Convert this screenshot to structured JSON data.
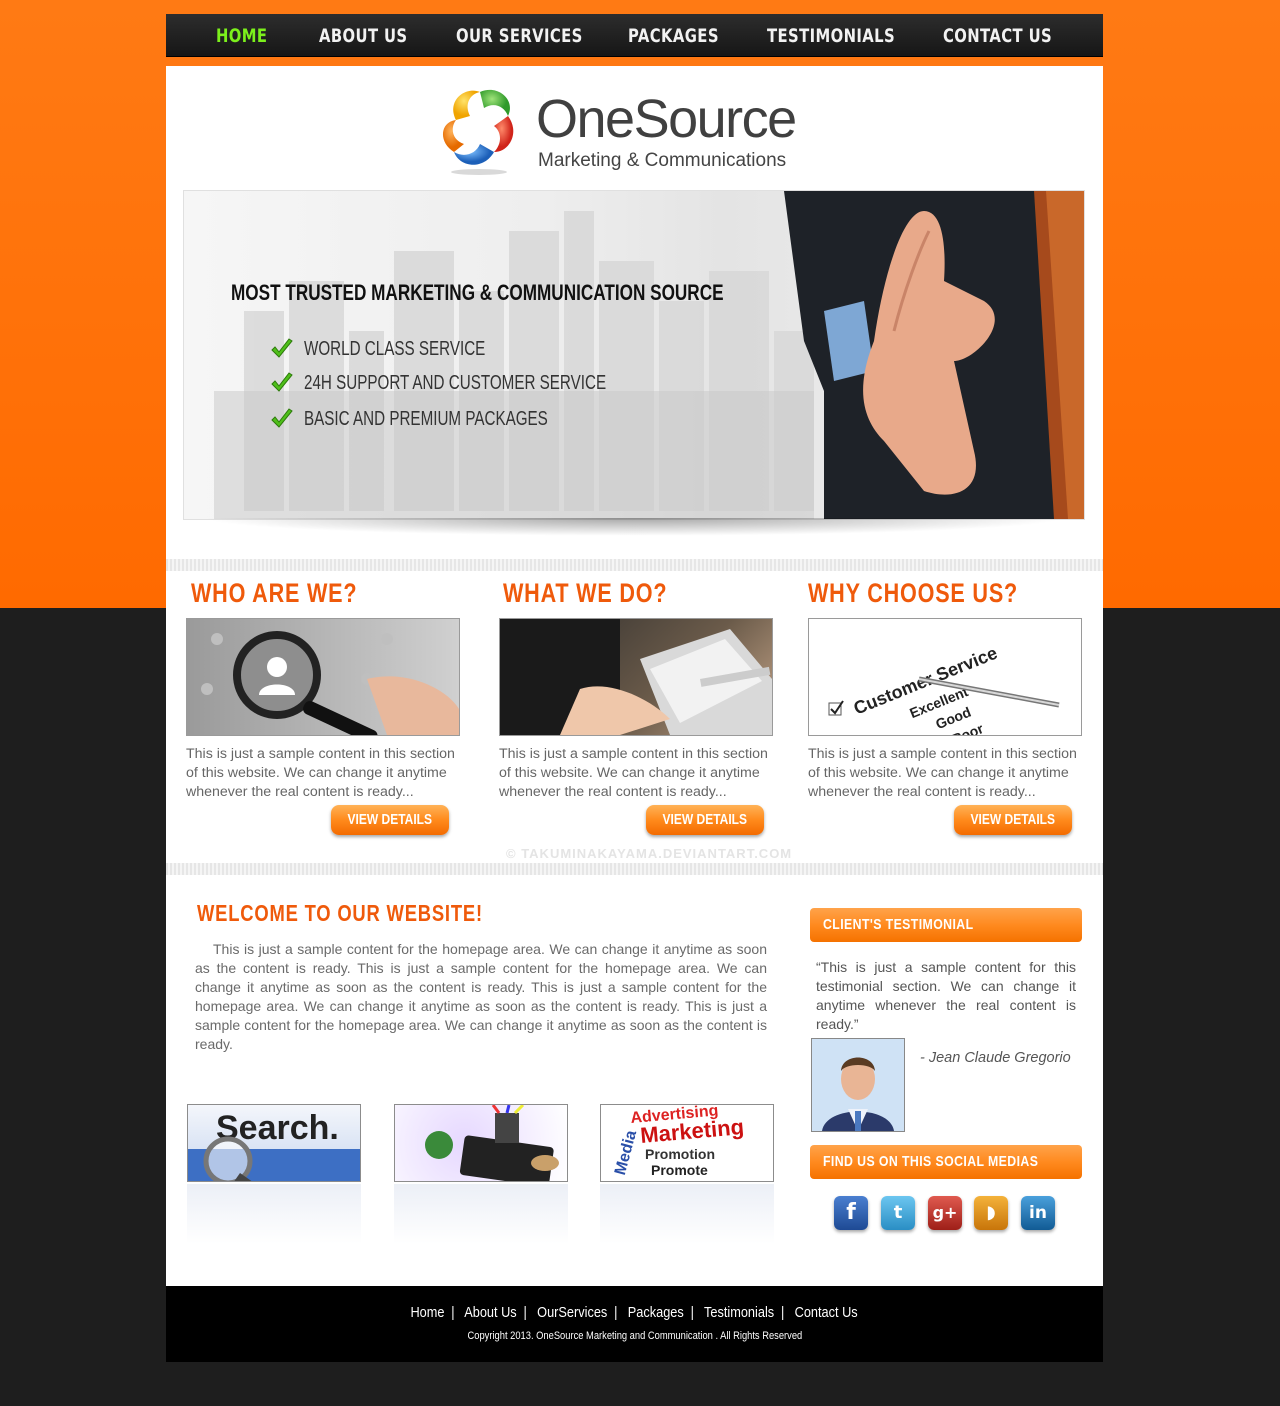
{
  "nav": {
    "items": [
      {
        "label": "HOME",
        "active": true
      },
      {
        "label": "ABOUT US"
      },
      {
        "label": "OUR SERVICES"
      },
      {
        "label": "PACKAGES"
      },
      {
        "label": "TESTIMONIALS"
      },
      {
        "label": "CONTACT US"
      }
    ]
  },
  "logo": {
    "name": "OneSource",
    "tagline": "Marketing & Communications"
  },
  "hero": {
    "headline": "MOST TRUSTED MARKETING  & COMMUNICATION SOURCE",
    "features": [
      "WORLD CLASS SERVICE",
      "24H SUPPORT AND CUSTOMER SERVICE",
      "BASIC AND PREMIUM PACKAGES"
    ]
  },
  "columns": [
    {
      "title": "WHO ARE WE?",
      "text": "This is just a sample content in this section of this website. We can change it anytime whenever the real content is ready...",
      "button": "VIEW DETAILS"
    },
    {
      "title": "WHAT WE DO?",
      "text": "This is just a sample content in this section of this website. We can change it anytime whenever the real content is ready...",
      "button": "VIEW DETAILS"
    },
    {
      "title": "WHY CHOOSE US?",
      "text": "This is just a sample content in this section of this website. We can change it anytime whenever the real content is ready...",
      "button": "VIEW DETAILS",
      "image_text": {
        "heading": "Customer Service",
        "options": [
          "Excellent",
          "Good",
          "Poor"
        ]
      }
    }
  ],
  "watermark": "© TAKUMINAKAYAMA.DEVIANTART.COM",
  "welcome": {
    "title": "WELCOME TO OUR WEBSITE!",
    "text": "This is just a sample content for the homepage area. We can change it anytime as soon as the content is ready.  This is just a sample content for the homepage area. We can change it anytime as soon as the content is ready.  This is just a sample content for the homepage area. We can change it anytime as soon as the content is ready. This is just a sample content for the homepage area. We can change it anytime as soon as the content is ready."
  },
  "thumbnails": {
    "search_label": "Search.",
    "marketing_words": [
      "Advertising",
      "Marketing",
      "Promotion",
      "Promote",
      "Media"
    ]
  },
  "sidebar": {
    "testimonial_title": "CLIENT'S TESTIMONIAL",
    "testimonial_text": "“This is just a sample content for this testimonial section. We can change it anytime whenever the real content is ready.”",
    "client_name": "- Jean Claude Gregorio",
    "social_title": "FIND US ON THIS SOCIAL MEDIAS",
    "social": [
      {
        "icon": "facebook-icon",
        "glyph": "f",
        "color": "#2b5ca8"
      },
      {
        "icon": "twitter-icon",
        "glyph": "t",
        "color": "#3aa4d8"
      },
      {
        "icon": "google-plus-icon",
        "glyph": "g+",
        "color": "#c1302a"
      },
      {
        "icon": "rss-icon",
        "glyph": "◗",
        "color": "#e7950f"
      },
      {
        "icon": "linkedin-icon",
        "glyph": "in",
        "color": "#1f78b4"
      }
    ]
  },
  "footer": {
    "links": [
      "Home",
      "About Us",
      "OurServices",
      "Packages",
      "Testimonials",
      "Contact Us"
    ],
    "copyright": "Copyright 2013. OneSource Marketing and Communication . All Rights Reserved"
  },
  "colors": {
    "accent_orange": "#ff6a00",
    "nav_active": "#7cf01c",
    "title_orange": "#ef5a0b"
  }
}
